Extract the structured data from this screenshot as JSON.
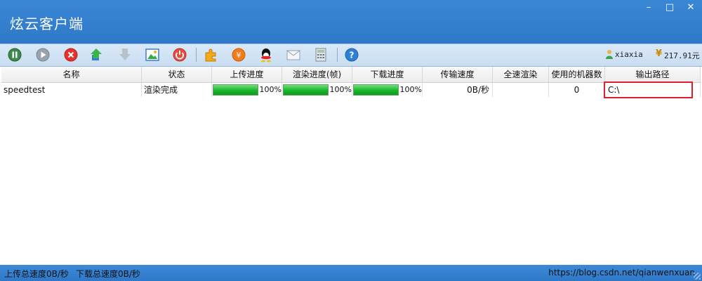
{
  "window": {
    "title": "炫云客户端",
    "min": "–",
    "max": "□",
    "close": "✕"
  },
  "toolbar": {
    "buttons": [
      "pause-icon",
      "play-icon",
      "delete-icon",
      "upload-icon",
      "download-icon",
      "image-icon",
      "stop-icon",
      "plugin-icon",
      "yuan-icon",
      "qq-icon",
      "mail-icon",
      "calculator-icon",
      "help-icon"
    ],
    "user": "xiaxia",
    "balance": "217.91元"
  },
  "table": {
    "columns": [
      "名称",
      "状态",
      "上传进度",
      "渲染进度(帧)",
      "下载进度",
      "传输速度",
      "全速渲染",
      "使用的机器数",
      "输出路径"
    ],
    "rows": [
      {
        "name": "speedtest",
        "status": "渲染完成",
        "upload": "100%",
        "render": "100%",
        "download": "100%",
        "speed": "0B/秒",
        "fullspeed": "",
        "machines": "0",
        "path": "C:\\"
      }
    ]
  },
  "statusbar": {
    "up": "上传总速度0B/秒",
    "down": "下载总速度0B/秒",
    "watermark": "https://blog.csdn.net/qianwenxuan"
  },
  "colors": {
    "title_blue": "#2f78c8",
    "progress_green": "#19b52b",
    "highlight_red": "#e0202a"
  }
}
